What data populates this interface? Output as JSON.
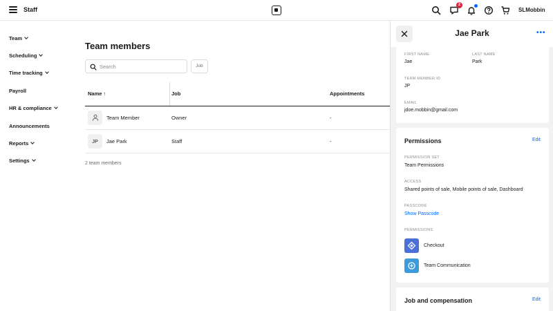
{
  "app": {
    "title": "Staff",
    "account_name": "SLMobbin",
    "notification_count": "2"
  },
  "icons": {
    "menu": "hamburger-icon",
    "logo": "square-logo-icon",
    "search": "search-icon",
    "messages": "chat-icon",
    "notifications": "bell-icon",
    "help": "help-icon",
    "cart": "cart-icon"
  },
  "sidebar": {
    "items": [
      {
        "label": "Team",
        "expandable": true
      },
      {
        "label": "Scheduling",
        "expandable": true
      },
      {
        "label": "Time tracking",
        "expandable": true
      },
      {
        "label": "Payroll",
        "expandable": false
      },
      {
        "label": "HR & compliance",
        "expandable": true
      },
      {
        "label": "Announcements",
        "expandable": false
      },
      {
        "label": "Reports",
        "expandable": true
      },
      {
        "label": "Settings",
        "expandable": true
      }
    ]
  },
  "main": {
    "title": "Team members",
    "search_placeholder": "Search",
    "filter_label": "Job",
    "columns": {
      "name": "Name",
      "sort_indicator": "↑",
      "job": "Job",
      "appointments": "Appointments"
    },
    "rows": [
      {
        "avatar": "person-icon",
        "initials": "",
        "name": "Team Member",
        "job": "Owner",
        "appointments": "-"
      },
      {
        "avatar": "",
        "initials": "JP",
        "name": "Jae Park",
        "job": "Staff",
        "appointments": "-"
      }
    ],
    "count_text": "2 team members"
  },
  "panel": {
    "title": "Jae Park",
    "more": "•••",
    "profile": {
      "first_name_label": "FIRST NAME",
      "first_name": "Jae",
      "last_name_label": "LAST NAME",
      "last_name": "Park",
      "team_member_id_label": "TEAM MEMBER ID",
      "team_member_id": "JP",
      "email_label": "EMAIL",
      "email": "jdoe.mobbin@gmail.com"
    },
    "permissions": {
      "title": "Permissions",
      "edit": "Edit",
      "permission_set_label": "PERMISSION SET",
      "permission_set": "Team Permissions",
      "access_label": "ACCESS",
      "access": "Shared points of sale, Mobile points of sale, Dashboard",
      "passcode_label": "PASSCODE",
      "passcode_link": "Show Passcode",
      "permissions_label": "PERMISSIONS",
      "items": [
        {
          "label": "Checkout",
          "icon": "checkout-icon",
          "color": "#4a6fd6"
        },
        {
          "label": "Team Communication",
          "icon": "team-communication-icon",
          "color": "#3f9bd8"
        }
      ]
    },
    "job_compensation": {
      "title": "Job and compensation",
      "edit": "Edit"
    }
  }
}
